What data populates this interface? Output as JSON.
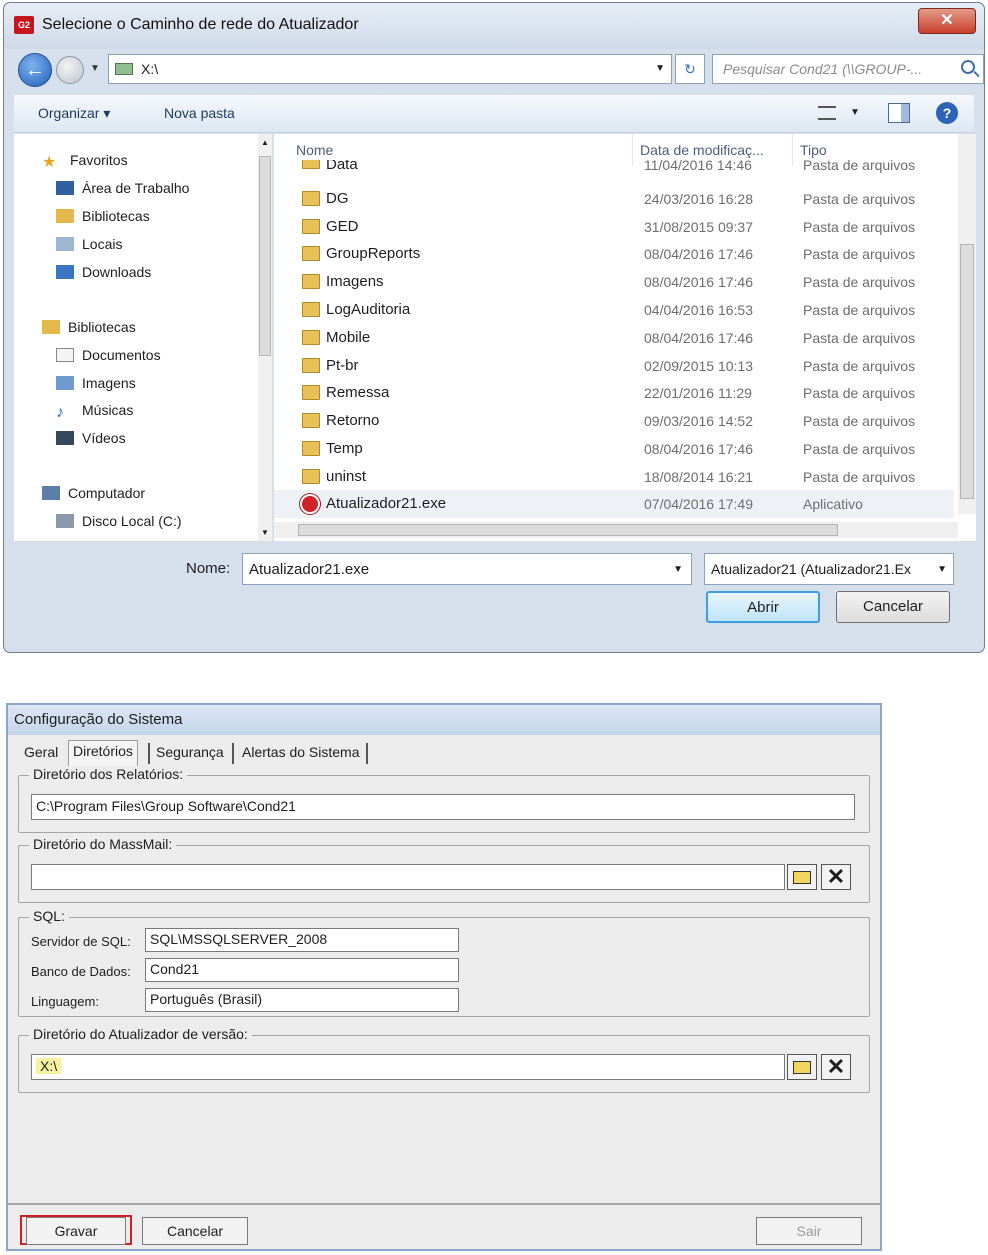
{
  "file_dialog": {
    "title": "Selecione o Caminho de rede do Atualizador",
    "app_icon_text": "G2",
    "close_label": "✕",
    "address": "X:\\",
    "search_placeholder": "Pesquisar Cond21 (\\\\GROUP-...",
    "toolbar": {
      "organize": "Organizar ▾",
      "new_folder": "Nova pasta"
    },
    "nav": {
      "favorites_header": "Favoritos",
      "favorites": [
        "Área de Trabalho",
        "Bibliotecas",
        "Locais",
        "Downloads"
      ],
      "libraries_header": "Bibliotecas",
      "libraries": [
        "Documentos",
        "Imagens",
        "Músicas",
        "Vídeos"
      ],
      "computer_header": "Computador",
      "computer": [
        "Disco Local (C:)"
      ]
    },
    "columns": {
      "name": "Nome",
      "date": "Data de modificaç...",
      "type": "Tipo"
    },
    "files": [
      {
        "name": "Data",
        "date": "11/04/2016 14:46",
        "type": "Pasta de arquivos"
      },
      {
        "name": "DG",
        "date": "24/03/2016 16:28",
        "type": "Pasta de arquivos"
      },
      {
        "name": "GED",
        "date": "31/08/2015 09:37",
        "type": "Pasta de arquivos"
      },
      {
        "name": "GroupReports",
        "date": "08/04/2016 17:46",
        "type": "Pasta de arquivos"
      },
      {
        "name": "Imagens",
        "date": "08/04/2016 17:46",
        "type": "Pasta de arquivos"
      },
      {
        "name": "LogAuditoria",
        "date": "04/04/2016 16:53",
        "type": "Pasta de arquivos"
      },
      {
        "name": "Mobile",
        "date": "08/04/2016 17:46",
        "type": "Pasta de arquivos"
      },
      {
        "name": "Pt-br",
        "date": "02/09/2015 10:13",
        "type": "Pasta de arquivos"
      },
      {
        "name": "Remessa",
        "date": "22/01/2016 11:29",
        "type": "Pasta de arquivos"
      },
      {
        "name": "Retorno",
        "date": "09/03/2016 14:52",
        "type": "Pasta de arquivos"
      },
      {
        "name": "Temp",
        "date": "08/04/2016 17:46",
        "type": "Pasta de arquivos"
      },
      {
        "name": "uninst",
        "date": "18/08/2014 16:21",
        "type": "Pasta de arquivos"
      },
      {
        "name": "Atualizador21.exe",
        "date": "07/04/2016 17:49",
        "type": "Aplicativo"
      }
    ],
    "name_label": "Nome:",
    "name_value": "Atualizador21.exe",
    "filter_value": "Atualizador21 (Atualizador21.Ex",
    "open_button": "Abrir",
    "cancel_button": "Cancelar"
  },
  "config_dialog": {
    "title": "Configuração do Sistema",
    "tabs": [
      "Geral",
      "Diretórios",
      "Segurança",
      "Alertas do Sistema"
    ],
    "reports_legend": "Diretório dos Relatórios:",
    "reports_path": "C:\\Program Files\\Group Software\\Cond21",
    "massmail_legend": "Diretório do MassMail:",
    "massmail_path": "",
    "sql_legend": "SQL:",
    "sql_server_label": "Servidor de SQL:",
    "sql_server_value": "SQL\\MSSQLSERVER_2008",
    "database_label": "Banco de Dados:",
    "database_value": "Cond21",
    "language_label": "Linguagem:",
    "language_value": "Português (Brasil)",
    "updater_legend": "Diretório do Atualizador de versão:",
    "updater_path": "X:\\",
    "save_button": "Gravar",
    "cancel_button": "Cancelar",
    "exit_button": "Sair"
  },
  "colors": {
    "highlight_border": "#d12027",
    "dialog_frame": "#d6e0ec",
    "folder": "#e8c158"
  }
}
